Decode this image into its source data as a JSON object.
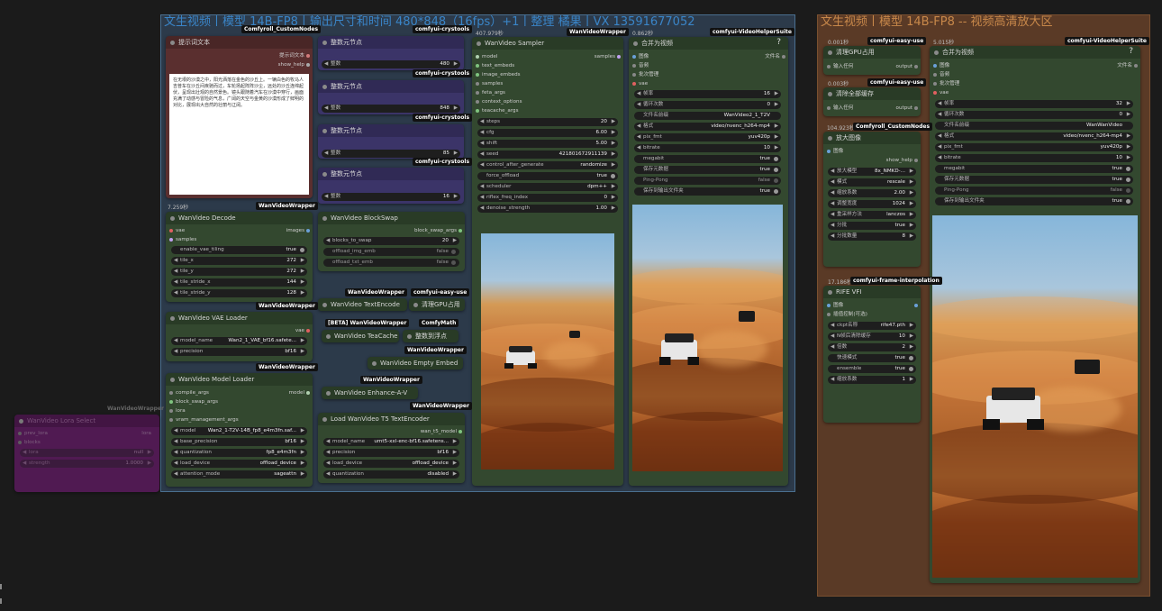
{
  "groups": {
    "main": {
      "title": "文生视频丨模型 14B-FP8丨输出尺寸和时间 480*848（16fps）+1丨整理 橘果丨VX 13591677052"
    },
    "upscale": {
      "title": "文生视频丨模型 14B-FP8 -- 视频高清放大区"
    }
  },
  "colors": {
    "main_group_border": "#4a6f8f",
    "main_group_bg": "#2c3a4a",
    "upscale_group_bg": "#5a3a26",
    "node_green": "#33482f",
    "node_purple": "#3b3468",
    "node_red": "#5a2f2f",
    "node_magenta": "#5a1a5c"
  },
  "prompt_node": {
    "tag": "Comfyroll_CustomNodes",
    "title": "提示词文本",
    "rows": [
      {
        "label": "提示词文本"
      },
      {
        "label": "show_help"
      }
    ],
    "text": "在无垠的沙漠之中，阳光洒落在金色的沙丘上。一辆白色的牧马人吉普车在沙丘间疾驰而过，车轮扬起阵阵沙尘，远处的沙丘连绵起伏，呈现出壮观的自然景色。镜头跟随着汽车在沙漠中穿行，画面充满了动感与冒险的气息，广阔的天空与金黄的沙漠形成了鲜明的对比，展现出大自然的壮丽与辽阔。"
  },
  "int_nodes": [
    {
      "tag": "comfyui-crystools",
      "title": "整数元节点",
      "label": "整数",
      "value": "480"
    },
    {
      "tag": "comfyui-crystools",
      "title": "整数元节点",
      "label": "整数",
      "value": ""
    },
    {
      "tag": "comfyui-crystools",
      "title": "整数元节点",
      "label": "整数",
      "value": "848"
    },
    {
      "tag": "comfyui-crystools",
      "title": "整数元节点",
      "label": "整数",
      "value": "85"
    },
    {
      "tag": "",
      "title": "整数元节点",
      "label": "整数",
      "value": "16"
    }
  ],
  "decode": {
    "time": "7.259秒",
    "tag": "WanVideoWrapper",
    "title": "WanVideo Decode",
    "inputs": [
      "vae",
      "samples"
    ],
    "output": "images",
    "widgets": [
      {
        "label": "enable_vae_tiling",
        "value": "true",
        "kind": "toggle"
      },
      {
        "label": "tile_x",
        "value": "272"
      },
      {
        "label": "tile_y",
        "value": "272"
      },
      {
        "label": "tile_stride_x",
        "value": "144"
      },
      {
        "label": "tile_stride_y",
        "value": "128"
      }
    ]
  },
  "vae_loader": {
    "tag": "WanVideoWrapper",
    "title": "WanVideo VAE Loader",
    "output": "vae",
    "widgets": [
      {
        "label": "model_name",
        "value": "Wan2_1_VAE_bf16.safete..."
      },
      {
        "label": "precision",
        "value": "bf16"
      }
    ]
  },
  "model_loader": {
    "tag": "WanVideoWrapper",
    "title": "WanVideo Model Loader",
    "inputs": [
      "compile_args",
      "block_swap_args",
      "lora",
      "vram_management_args"
    ],
    "output": "model",
    "widgets": [
      {
        "label": "model",
        "value": "Wan2_1-T2V-14B_fp8_e4m3fn.saf..."
      },
      {
        "label": "base_precision",
        "value": "bf16"
      },
      {
        "label": "quantization",
        "value": "fp8_e4m3fn"
      },
      {
        "label": "load_device",
        "value": "offload_device"
      },
      {
        "label": "attention_mode",
        "value": "sageattn"
      }
    ]
  },
  "lora_node": {
    "tag": "WanVideoWrapper",
    "title": "WanVideo Lora Select",
    "inputs": [
      "prev_lora",
      "blocks"
    ],
    "output": "lora",
    "widgets": [
      {
        "label": "lora",
        "value": "null"
      },
      {
        "label": "strength",
        "value": "1.0000"
      }
    ]
  },
  "blockswap": {
    "tag": "WanVideoWrapper",
    "title": "WanVideo BlockSwap",
    "output": "block_swap_args",
    "widgets": [
      {
        "label": "blocks_to_swap",
        "value": "20"
      },
      {
        "label": "offload_img_emb",
        "value": "false",
        "kind": "toggle"
      },
      {
        "label": "offload_txt_emb",
        "value": "false",
        "kind": "toggle"
      }
    ]
  },
  "textencode": {
    "tag": "WanVideoWrapper",
    "title": "WanVideo TextEncode"
  },
  "gpu_clear": {
    "tag": "comfyui-easy-use",
    "title": "清理GPU占用"
  },
  "teacache": {
    "tag": "[BETA] WanVideoWrapper",
    "title": "WanVideo TeaCache"
  },
  "float_node": {
    "tag": "ComfyMath",
    "title": "整数到浮点"
  },
  "empty_embed": {
    "tag": "WanVideoWrapper",
    "title": "WanVideo Empty Embed"
  },
  "enhance": {
    "tag": "WanVideoWrapper",
    "title": "WanVideo Enhance-A-V"
  },
  "t5_loader": {
    "tag": "WanVideoWrapper",
    "title": "Load WanVideo T5 TextEncoder",
    "output": "wan_t5_model",
    "widgets": [
      {
        "label": "model_name",
        "value": "umt5-xxl-enc-bf16.safetens..."
      },
      {
        "label": "precision",
        "value": "bf16"
      },
      {
        "label": "load_device",
        "value": "offload_device"
      },
      {
        "label": "quantization",
        "value": "disabled"
      }
    ]
  },
  "sampler": {
    "time": "407.979秒",
    "tag": "WanVideoWrapper",
    "title": "WanVideo Sampler",
    "inputs": [
      "model",
      "text_embeds",
      "image_embeds",
      "samples",
      "feta_args",
      "context_options",
      "teacache_args"
    ],
    "output": "samples",
    "widgets": [
      {
        "label": "steps",
        "value": "20"
      },
      {
        "label": "cfg",
        "value": "6.00"
      },
      {
        "label": "shift",
        "value": "5.00"
      },
      {
        "label": "seed",
        "value": "421801672911139"
      },
      {
        "label": "control_after_generate",
        "value": "randomize"
      },
      {
        "label": "force_offload",
        "value": "true",
        "kind": "toggle"
      },
      {
        "label": "scheduler",
        "value": "dpm++"
      },
      {
        "label": "riflex_freq_index",
        "value": "0"
      },
      {
        "label": "denoise_strength",
        "value": "1.00"
      }
    ]
  },
  "combine1": {
    "time": "0.862秒",
    "tag": "comfyui-VideoHelperSuite",
    "title": "合并为视频",
    "help": "?",
    "inputs": [
      "图像",
      "音频",
      "批次管理",
      "vae"
    ],
    "output": "文件名",
    "widgets": [
      {
        "label": "帧率",
        "value": "16"
      },
      {
        "label": "循环次数",
        "value": "0"
      },
      {
        "label": "文件名前缀",
        "value": "WanVideo2_1_T2V"
      },
      {
        "label": "格式",
        "value": "video/nvenc_h264-mp4"
      },
      {
        "label": "pix_fmt",
        "value": "yuv420p"
      },
      {
        "label": "bitrate",
        "value": "10"
      },
      {
        "label": "megabit",
        "value": "true",
        "kind": "toggle"
      },
      {
        "label": "保存元数据",
        "value": "true",
        "kind": "toggle"
      },
      {
        "label": "Ping-Pong",
        "value": "false",
        "kind": "toggle"
      },
      {
        "label": "保存到输出文件夹",
        "value": "true",
        "kind": "toggle"
      }
    ]
  },
  "gpu1": {
    "time": "0.001秒",
    "tag": "comfyui-easy-use",
    "title": "清理GPU占用",
    "input": "输入任何",
    "output": "output"
  },
  "mem": {
    "time": "0.003秒",
    "tag": "comfyui-easy-use",
    "title": "清除全部缓存",
    "input": "输入任何",
    "output": "output"
  },
  "upscale": {
    "time": "104.923秒",
    "tag": "Comfyroll_CustomNodes",
    "title": "放大图像",
    "input": "图像",
    "output": "show_help",
    "widgets": [
      {
        "label": "放大模型",
        "value": "8x_NMKD-..."
      },
      {
        "label": "模式",
        "value": "rescale"
      },
      {
        "label": "缩放系数",
        "value": "2.00"
      },
      {
        "label": "调整宽度",
        "value": "1024"
      },
      {
        "label": "重采样方法",
        "value": "lanczos"
      },
      {
        "label": "分批",
        "value": "true"
      },
      {
        "label": "分批数量",
        "value": "8"
      }
    ]
  },
  "rife": {
    "time": "17.186秒",
    "tag": "comfyui-frame-interpolation",
    "title": "RIFE VFI",
    "inputs": [
      "图像",
      "插值控制(可选)"
    ],
    "widgets": [
      {
        "label": "ckpt名称",
        "value": "rife47.pth"
      },
      {
        "label": "N帧后清除缓存",
        "value": "10"
      },
      {
        "label": "倍数",
        "value": "2"
      },
      {
        "label": "快速模式",
        "value": "true",
        "kind": "toggle"
      },
      {
        "label": "ensemble",
        "value": "true",
        "kind": "toggle"
      },
      {
        "label": "缩放系数",
        "value": "1"
      }
    ]
  },
  "combine2": {
    "time": "5.015秒",
    "tag": "comfyui-VideoHelperSuite",
    "title": "合并为视频",
    "help": "?",
    "inputs": [
      "图像",
      "音频",
      "批次管理",
      "vae"
    ],
    "output": "文件名",
    "widgets": [
      {
        "label": "帧率",
        "value": "32"
      },
      {
        "label": "循环次数",
        "value": "0"
      },
      {
        "label": "文件名前缀",
        "value": "WanWanVideo"
      },
      {
        "label": "格式",
        "value": "video/nvenc_h264-mp4"
      },
      {
        "label": "pix_fmt",
        "value": "yuv420p"
      },
      {
        "label": "bitrate",
        "value": "10"
      },
      {
        "label": "megabit",
        "value": "true",
        "kind": "toggle"
      },
      {
        "label": "保存元数据",
        "value": "true",
        "kind": "toggle"
      },
      {
        "label": "Ping-Pong",
        "value": "false",
        "kind": "toggle"
      },
      {
        "label": "保存到输出文件夹",
        "value": "true",
        "kind": "toggle"
      }
    ]
  }
}
